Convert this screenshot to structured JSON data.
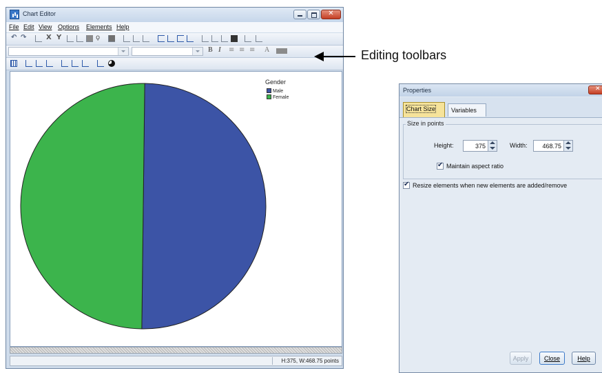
{
  "chart_editor": {
    "title": "Chart Editor",
    "menu": [
      "File",
      "Edit",
      "View",
      "Options",
      "Elements",
      "Help"
    ],
    "status": "H:375, W:468.75 points",
    "window_controls": {
      "close": "✕"
    }
  },
  "toolbar": {
    "bold": "B",
    "italic": "I",
    "text_size": "A",
    "callout": "Editing toolbars"
  },
  "chart_data": {
    "type": "pie",
    "legend_title": "Gender",
    "legend_position": "top-right",
    "categories": [
      "Male",
      "Female"
    ],
    "values": [
      50,
      50
    ],
    "colors": [
      "#3c54a6",
      "#3cb44c"
    ]
  },
  "properties": {
    "title": "Properties",
    "close_glyph": "✕",
    "tabs": [
      "Chart Size",
      "Variables"
    ],
    "group_label": "Size in points",
    "height_label": "Height:",
    "height_value": "375",
    "width_label": "Width:",
    "width_value": "468.75",
    "maintain_aspect": "Maintain aspect ratio",
    "maintain_aspect_checked": true,
    "resize_elements": "Resize elements when new elements are added/remove",
    "resize_elements_checked": true,
    "buttons": {
      "apply": "Apply",
      "close": "Close",
      "help": "Help"
    }
  }
}
